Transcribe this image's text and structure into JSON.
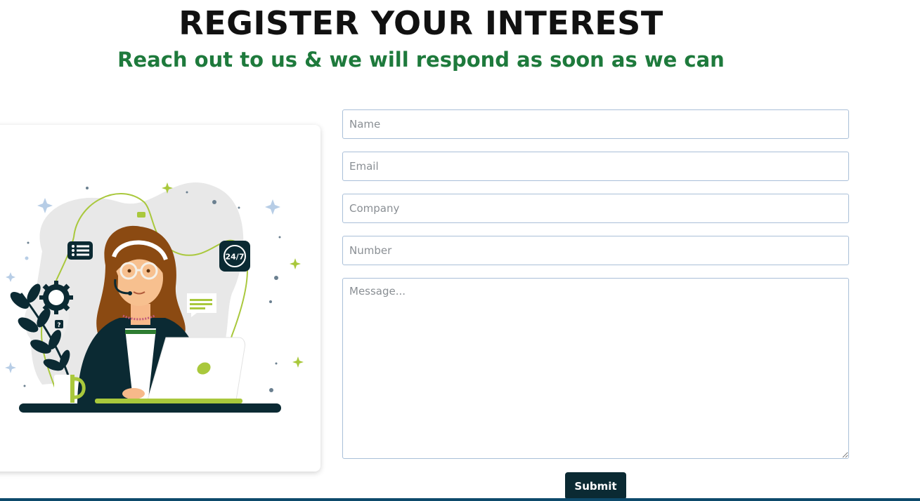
{
  "header": {
    "title": "REGISTER YOUR INTEREST",
    "subtitle": "Reach out to us & we will respond as soon as we can"
  },
  "illustration": {
    "badge_247": "24/7",
    "badge_help": "?"
  },
  "form": {
    "name_placeholder": "Name",
    "email_placeholder": "Email",
    "company_placeholder": "Company",
    "number_placeholder": "Number",
    "message_placeholder": "Message...",
    "submit_label": "Submit"
  },
  "colors": {
    "title": "#111111",
    "subtitle": "#1e7a3c",
    "button_bg": "#0b2a33",
    "accent_green": "#a9c83c",
    "navy": "#0b2a33",
    "bottom_bar": "#0d4a6b"
  },
  "icons": [
    "list-icon",
    "gear-icon",
    "clock-24-7-icon",
    "chat-bubble-icon",
    "help-icon",
    "sparkle-icon"
  ]
}
